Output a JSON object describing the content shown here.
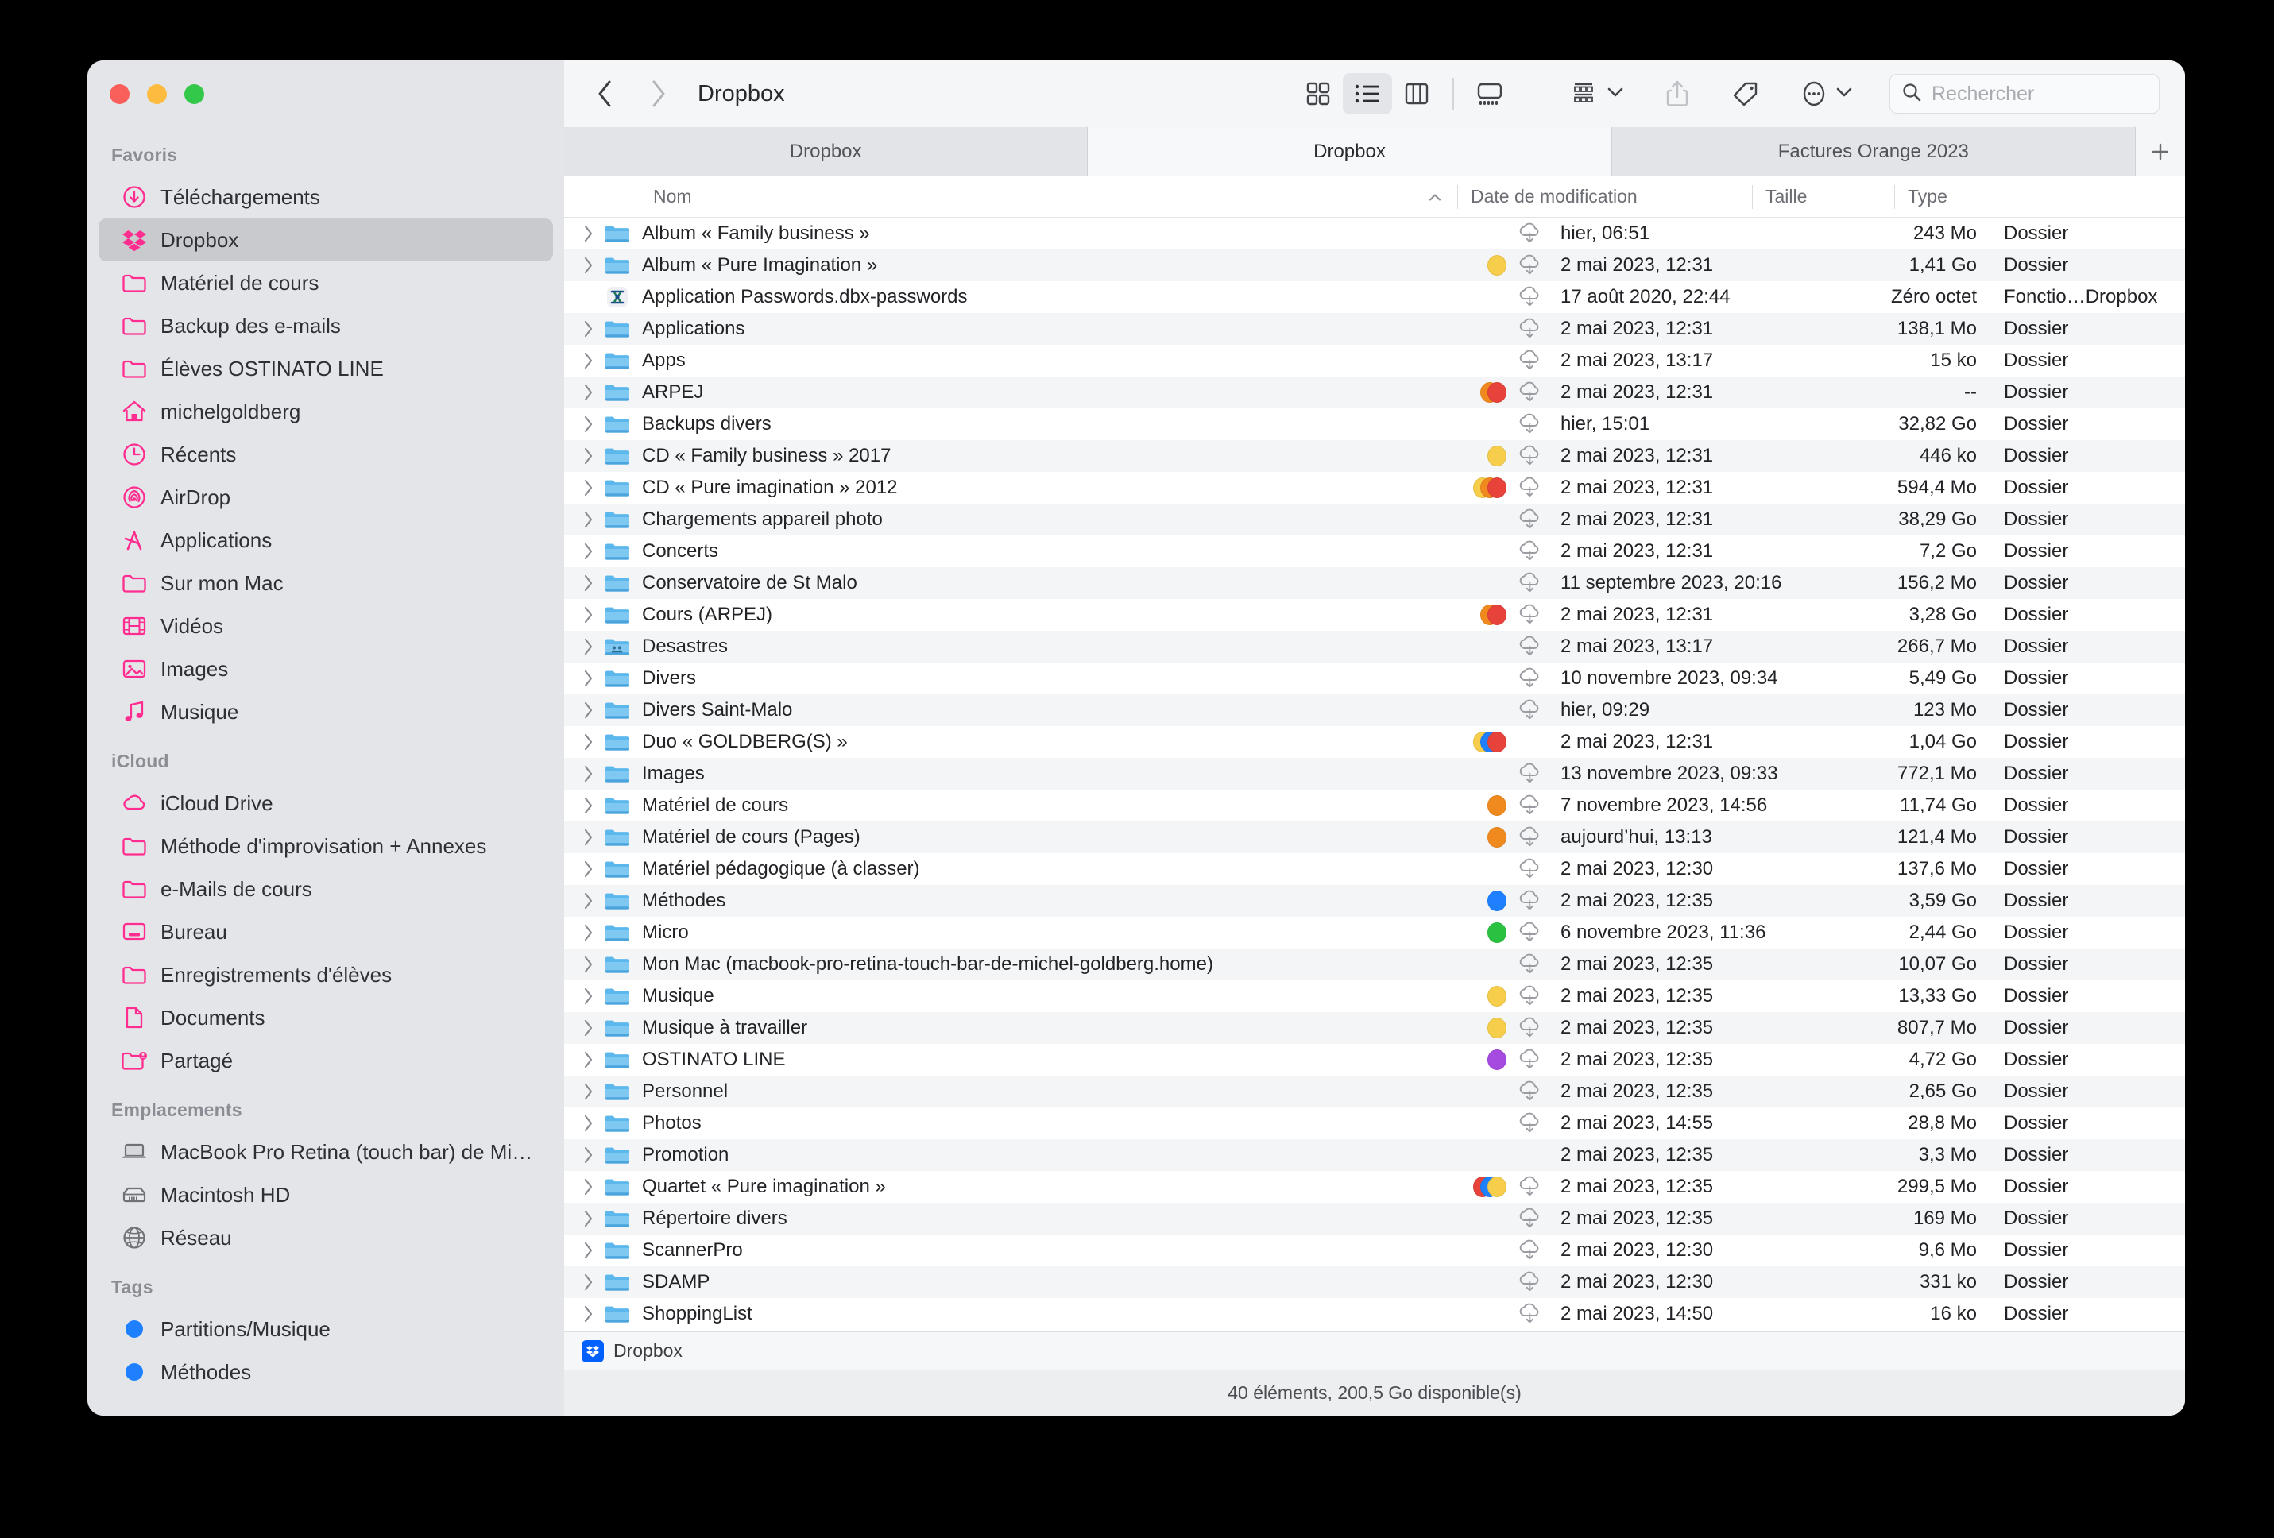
{
  "window": {
    "traffic_lights": [
      "close",
      "minimize",
      "maximize"
    ],
    "colors": {
      "close": "#f9605b",
      "minimize": "#fdbc40",
      "maximize": "#34c84a",
      "accent_pink": "#ff2d8f"
    }
  },
  "toolbar": {
    "back_icon": "chevron-left-icon",
    "forward_icon": "chevron-right-icon",
    "title": "Dropbox",
    "view_buttons": [
      {
        "name": "icon-view",
        "label": "Icônes",
        "active": false
      },
      {
        "name": "list-view",
        "label": "Liste",
        "active": true
      },
      {
        "name": "column-view",
        "label": "Colonnes",
        "active": false
      },
      {
        "name": "gallery-view",
        "label": "Galerie",
        "active": false
      }
    ],
    "group_icon": "group-by-icon",
    "share_icon": "share-icon",
    "tag_icon": "tag-icon",
    "more_icon": "ellipsis-icon"
  },
  "search": {
    "placeholder": "Rechercher",
    "value": "",
    "icon": "search-icon"
  },
  "tabs": [
    {
      "label": "Dropbox",
      "active": false
    },
    {
      "label": "Dropbox",
      "active": true
    },
    {
      "label": "Factures Orange 2023",
      "active": false
    }
  ],
  "tab_add_label": "+",
  "columns": {
    "name": "Nom",
    "date": "Date de modification",
    "size": "Taille",
    "type": "Type",
    "sort_indicator": "∧"
  },
  "sidebar": {
    "sections": [
      {
        "title": "Favoris",
        "items": [
          {
            "label": "Téléchargements",
            "icon": "downloads-icon",
            "selected": false
          },
          {
            "label": "Dropbox",
            "icon": "dropbox-icon",
            "selected": true
          },
          {
            "label": "Matériel de cours",
            "icon": "folder-icon",
            "selected": false
          },
          {
            "label": "Backup des e-mails",
            "icon": "folder-icon",
            "selected": false
          },
          {
            "label": "Élèves OSTINATO LINE",
            "icon": "folder-icon",
            "selected": false
          },
          {
            "label": "michelgoldberg",
            "icon": "home-icon",
            "selected": false
          },
          {
            "label": "Récents",
            "icon": "clock-icon",
            "selected": false
          },
          {
            "label": "AirDrop",
            "icon": "airdrop-icon",
            "selected": false
          },
          {
            "label": "Applications",
            "icon": "applications-icon",
            "selected": false
          },
          {
            "label": "Sur mon Mac",
            "icon": "folder-icon",
            "selected": false
          },
          {
            "label": "Vidéos",
            "icon": "film-icon",
            "selected": false
          },
          {
            "label": "Images",
            "icon": "photo-icon",
            "selected": false
          },
          {
            "label": "Musique",
            "icon": "music-note-icon",
            "selected": false
          }
        ]
      },
      {
        "title": "iCloud",
        "items": [
          {
            "label": "iCloud Drive",
            "icon": "cloud-icon",
            "selected": false
          },
          {
            "label": "Méthode d'improvisation + Annexes",
            "icon": "folder-icon",
            "selected": false
          },
          {
            "label": "e-Mails de cours",
            "icon": "folder-icon",
            "selected": false
          },
          {
            "label": "Bureau",
            "icon": "desktop-icon",
            "selected": false
          },
          {
            "label": "Enregistrements d'élèves",
            "icon": "folder-icon",
            "selected": false
          },
          {
            "label": "Documents",
            "icon": "document-icon",
            "selected": false
          },
          {
            "label": "Partagé",
            "icon": "shared-folder-icon",
            "selected": false
          }
        ]
      },
      {
        "title": "Emplacements",
        "items": [
          {
            "label": "MacBook Pro Retina (touch bar) de Mi…",
            "icon": "laptop-icon",
            "selected": false
          },
          {
            "label": "Macintosh HD",
            "icon": "harddisk-icon",
            "selected": false
          },
          {
            "label": "Réseau",
            "icon": "globe-icon",
            "selected": false
          }
        ]
      },
      {
        "title": "Tags",
        "items": [
          {
            "label": "Partitions/Musique",
            "icon": "tag-dot-icon",
            "dot_color": "#1e80ff",
            "selected": false
          },
          {
            "label": "Méthodes",
            "icon": "tag-dot-icon",
            "dot_color": "#1e80ff",
            "selected": false
          }
        ]
      }
    ]
  },
  "files": [
    {
      "name": "Album « Family business »",
      "icon": "folder-icon",
      "expandable": true,
      "tags": [],
      "cloud": true,
      "date": "hier, 06:51",
      "size": "243 Mo",
      "type": "Dossier"
    },
    {
      "name": "Album « Pure Imagination »",
      "icon": "folder-icon",
      "expandable": true,
      "tags": [
        "#f6ce4b"
      ],
      "cloud": true,
      "date": "2 mai 2023, 12:31",
      "size": "1,41 Go",
      "type": "Dossier"
    },
    {
      "name": "Application Passwords.dbx-passwords",
      "icon": "dbx-passwords-icon",
      "expandable": false,
      "tags": [],
      "cloud": true,
      "date": "17 août 2020, 22:44",
      "size": "Zéro octet",
      "type": "Fonctio…Dropbox"
    },
    {
      "name": "Applications",
      "icon": "folder-icon",
      "expandable": true,
      "tags": [],
      "cloud": true,
      "date": "2 mai 2023, 12:31",
      "size": "138,1 Mo",
      "type": "Dossier"
    },
    {
      "name": "Apps",
      "icon": "folder-icon",
      "expandable": true,
      "tags": [],
      "cloud": true,
      "date": "2 mai 2023, 13:17",
      "size": "15 ko",
      "type": "Dossier"
    },
    {
      "name": "ARPEJ",
      "icon": "folder-icon",
      "expandable": true,
      "tags": [
        "#e8433b",
        "#f08a1e"
      ],
      "cloud": true,
      "date": "2 mai 2023, 12:31",
      "size": "--",
      "type": "Dossier"
    },
    {
      "name": "Backups divers",
      "icon": "folder-icon",
      "expandable": true,
      "tags": [],
      "cloud": true,
      "date": "hier, 15:01",
      "size": "32,82 Go",
      "type": "Dossier"
    },
    {
      "name": "CD « Family business » 2017",
      "icon": "folder-icon",
      "expandable": true,
      "tags": [
        "#f6ce4b"
      ],
      "cloud": true,
      "date": "2 mai 2023, 12:31",
      "size": "446 ko",
      "type": "Dossier"
    },
    {
      "name": "CD « Pure imagination » 2012",
      "icon": "folder-icon",
      "expandable": true,
      "tags": [
        "#e8433b",
        "#f08a1e",
        "#f6ce4b"
      ],
      "cloud": true,
      "date": "2 mai 2023, 12:31",
      "size": "594,4 Mo",
      "type": "Dossier"
    },
    {
      "name": "Chargements appareil photo",
      "icon": "folder-icon",
      "expandable": true,
      "tags": [],
      "cloud": true,
      "date": "2 mai 2023, 12:31",
      "size": "38,29 Go",
      "type": "Dossier"
    },
    {
      "name": "Concerts",
      "icon": "folder-icon",
      "expandable": true,
      "tags": [],
      "cloud": true,
      "date": "2 mai 2023, 12:31",
      "size": "7,2 Go",
      "type": "Dossier"
    },
    {
      "name": "Conservatoire de St Malo",
      "icon": "folder-icon",
      "expandable": true,
      "tags": [],
      "cloud": true,
      "date": "11 septembre 2023, 20:16",
      "size": "156,2 Mo",
      "type": "Dossier"
    },
    {
      "name": "Cours (ARPEJ)",
      "icon": "folder-icon",
      "expandable": true,
      "tags": [
        "#e8433b",
        "#f08a1e"
      ],
      "cloud": true,
      "date": "2 mai 2023, 12:31",
      "size": "3,28 Go",
      "type": "Dossier"
    },
    {
      "name": "Desastres",
      "icon": "shared-folder-icon",
      "expandable": true,
      "tags": [],
      "cloud": true,
      "date": "2 mai 2023, 13:17",
      "size": "266,7 Mo",
      "type": "Dossier"
    },
    {
      "name": "Divers",
      "icon": "folder-icon",
      "expandable": true,
      "tags": [],
      "cloud": true,
      "date": "10 novembre 2023, 09:34",
      "size": "5,49 Go",
      "type": "Dossier"
    },
    {
      "name": "Divers Saint-Malo",
      "icon": "folder-icon",
      "expandable": true,
      "tags": [],
      "cloud": true,
      "date": "hier, 09:29",
      "size": "123 Mo",
      "type": "Dossier"
    },
    {
      "name": "Duo « GOLDBERG(S) »",
      "icon": "folder-icon",
      "expandable": true,
      "tags": [
        "#e8433b",
        "#1e80ff",
        "#f6ce4b"
      ],
      "cloud": false,
      "date": "2 mai 2023, 12:31",
      "size": "1,04 Go",
      "type": "Dossier"
    },
    {
      "name": "Images",
      "icon": "folder-icon",
      "expandable": true,
      "tags": [],
      "cloud": true,
      "date": "13 novembre 2023, 09:33",
      "size": "772,1 Mo",
      "type": "Dossier"
    },
    {
      "name": "Matériel de cours",
      "icon": "folder-icon",
      "expandable": true,
      "tags": [
        "#f08a1e"
      ],
      "cloud": true,
      "date": "7 novembre 2023, 14:56",
      "size": "11,74 Go",
      "type": "Dossier"
    },
    {
      "name": "Matériel de cours (Pages)",
      "icon": "folder-icon",
      "expandable": true,
      "tags": [
        "#f08a1e"
      ],
      "cloud": true,
      "date": "aujourd’hui, 13:13",
      "size": "121,4 Mo",
      "type": "Dossier"
    },
    {
      "name": "Matériel pédagogique (à classer)",
      "icon": "folder-icon",
      "expandable": true,
      "tags": [],
      "cloud": true,
      "date": "2 mai 2023, 12:30",
      "size": "137,6 Mo",
      "type": "Dossier"
    },
    {
      "name": "Méthodes",
      "icon": "folder-icon",
      "expandable": true,
      "tags": [
        "#1e80ff"
      ],
      "cloud": true,
      "date": "2 mai 2023, 12:35",
      "size": "3,59 Go",
      "type": "Dossier"
    },
    {
      "name": "Micro",
      "icon": "folder-icon",
      "expandable": true,
      "tags": [
        "#2ac140"
      ],
      "cloud": true,
      "date": "6 novembre 2023, 11:36",
      "size": "2,44 Go",
      "type": "Dossier"
    },
    {
      "name": "Mon Mac (macbook-pro-retina-touch-bar-de-michel-goldberg.home)",
      "icon": "folder-icon",
      "expandable": true,
      "tags": [],
      "cloud": true,
      "date": "2 mai 2023, 12:35",
      "size": "10,07 Go",
      "type": "Dossier"
    },
    {
      "name": "Musique",
      "icon": "folder-icon",
      "expandable": true,
      "tags": [
        "#f6ce4b"
      ],
      "cloud": true,
      "date": "2 mai 2023, 12:35",
      "size": "13,33 Go",
      "type": "Dossier"
    },
    {
      "name": "Musique à travailler",
      "icon": "folder-icon",
      "expandable": true,
      "tags": [
        "#f6ce4b"
      ],
      "cloud": true,
      "date": "2 mai 2023, 12:35",
      "size": "807,7 Mo",
      "type": "Dossier"
    },
    {
      "name": "OSTINATO LINE",
      "icon": "folder-icon",
      "expandable": true,
      "tags": [
        "#a64be0"
      ],
      "cloud": true,
      "date": "2 mai 2023, 12:35",
      "size": "4,72 Go",
      "type": "Dossier"
    },
    {
      "name": "Personnel",
      "icon": "folder-icon",
      "expandable": true,
      "tags": [],
      "cloud": true,
      "date": "2 mai 2023, 12:35",
      "size": "2,65 Go",
      "type": "Dossier"
    },
    {
      "name": "Photos",
      "icon": "folder-icon",
      "expandable": true,
      "tags": [],
      "cloud": true,
      "date": "2 mai 2023, 14:55",
      "size": "28,8 Mo",
      "type": "Dossier"
    },
    {
      "name": "Promotion",
      "icon": "folder-icon",
      "expandable": true,
      "tags": [],
      "cloud": false,
      "date": "2 mai 2023, 12:35",
      "size": "3,3 Mo",
      "type": "Dossier"
    },
    {
      "name": "Quartet « Pure imagination »",
      "icon": "folder-icon",
      "expandable": true,
      "tags": [
        "#f6ce4b",
        "#1e80ff",
        "#e8433b"
      ],
      "cloud": true,
      "date": "2 mai 2023, 12:35",
      "size": "299,5 Mo",
      "type": "Dossier"
    },
    {
      "name": "Répertoire divers",
      "icon": "folder-icon",
      "expandable": true,
      "tags": [],
      "cloud": true,
      "date": "2 mai 2023, 12:35",
      "size": "169 Mo",
      "type": "Dossier"
    },
    {
      "name": "ScannerPro",
      "icon": "folder-icon",
      "expandable": true,
      "tags": [],
      "cloud": true,
      "date": "2 mai 2023, 12:30",
      "size": "9,6 Mo",
      "type": "Dossier"
    },
    {
      "name": "SDAMP",
      "icon": "folder-icon",
      "expandable": true,
      "tags": [],
      "cloud": true,
      "date": "2 mai 2023, 12:30",
      "size": "331 ko",
      "type": "Dossier"
    },
    {
      "name": "ShoppingList",
      "icon": "folder-icon",
      "expandable": true,
      "tags": [],
      "cloud": true,
      "date": "2 mai 2023, 14:50",
      "size": "16 ko",
      "type": "Dossier"
    }
  ],
  "path_bar": {
    "label": "Dropbox",
    "icon": "dropbox-icon"
  },
  "status_bar": {
    "text": "40 éléments, 200,5 Go disponible(s)"
  }
}
